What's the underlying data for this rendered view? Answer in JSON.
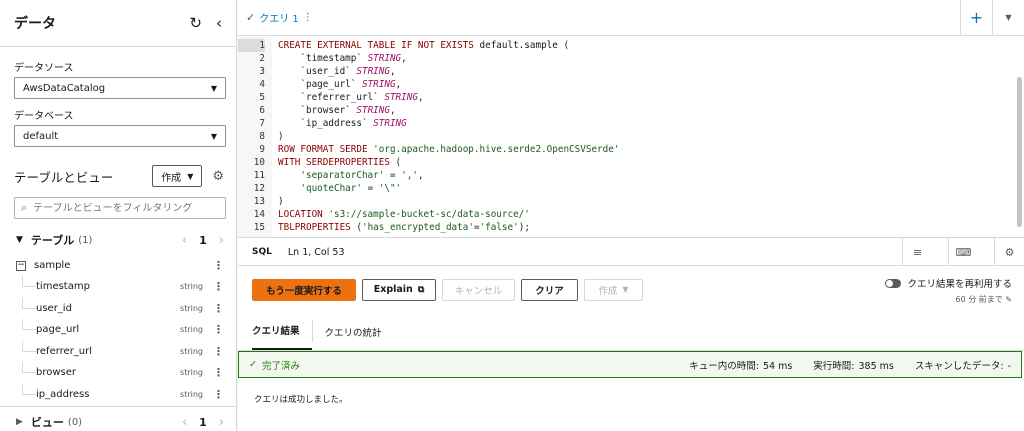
{
  "left": {
    "title": "データ",
    "datasource_label": "データソース",
    "datasource_value": "AwsDataCatalog",
    "database_label": "データベース",
    "database_value": "default",
    "tv_title": "テーブルとビュー",
    "create_label": "作成",
    "search_placeholder": "テーブルとビューをフィルタリング",
    "tables_label": "テーブル",
    "tables_count": "(1)",
    "tables_page": "1",
    "table_name": "sample",
    "columns": [
      {
        "name": "timestamp",
        "type": "string"
      },
      {
        "name": "user_id",
        "type": "string"
      },
      {
        "name": "page_url",
        "type": "string"
      },
      {
        "name": "referrer_url",
        "type": "string"
      },
      {
        "name": "browser",
        "type": "string"
      },
      {
        "name": "ip_address",
        "type": "string"
      }
    ],
    "views_label": "ビュー",
    "views_count": "(0)",
    "views_page": "1"
  },
  "editor": {
    "tab_label": "クエリ 1",
    "tab_more": "⋮",
    "language": "SQL",
    "cursor": "Ln 1, Col 53",
    "lines": [
      {
        "n": "1",
        "parts": [
          [
            "kw",
            "CREATE EXTERNAL TABLE IF NOT EXISTS "
          ],
          [
            "pl",
            "default.sample ("
          ]
        ]
      },
      {
        "n": "2",
        "parts": [
          [
            "pl",
            "    `timestamp` "
          ],
          [
            "ty",
            "STRING"
          ],
          [
            "pl",
            ","
          ]
        ]
      },
      {
        "n": "3",
        "parts": [
          [
            "pl",
            "    `user_id` "
          ],
          [
            "ty",
            "STRING"
          ],
          [
            "pl",
            ","
          ]
        ]
      },
      {
        "n": "4",
        "parts": [
          [
            "pl",
            "    `page_url` "
          ],
          [
            "ty",
            "STRING"
          ],
          [
            "pl",
            ","
          ]
        ]
      },
      {
        "n": "5",
        "parts": [
          [
            "pl",
            "    `referrer_url` "
          ],
          [
            "ty",
            "STRING"
          ],
          [
            "pl",
            ","
          ]
        ]
      },
      {
        "n": "6",
        "parts": [
          [
            "pl",
            "    `browser` "
          ],
          [
            "ty",
            "STRING"
          ],
          [
            "pl",
            ","
          ]
        ]
      },
      {
        "n": "7",
        "parts": [
          [
            "pl",
            "    `ip_address` "
          ],
          [
            "ty",
            "STRING"
          ]
        ]
      },
      {
        "n": "8",
        "parts": [
          [
            "pl",
            ")"
          ]
        ]
      },
      {
        "n": "9",
        "parts": [
          [
            "kw",
            "ROW FORMAT SERDE "
          ],
          [
            "st",
            "'org.apache.hadoop.hive.serde2.OpenCSVSerde'"
          ]
        ]
      },
      {
        "n": "10",
        "parts": [
          [
            "kw",
            "WITH SERDEPROPERTIES "
          ],
          [
            "pl",
            "("
          ]
        ]
      },
      {
        "n": "11",
        "parts": [
          [
            "pl",
            "    "
          ],
          [
            "st",
            "'separatorChar'"
          ],
          [
            "pl",
            " = "
          ],
          [
            "st",
            "','"
          ],
          [
            "pl",
            ","
          ]
        ]
      },
      {
        "n": "12",
        "parts": [
          [
            "pl",
            "    "
          ],
          [
            "st",
            "'quoteChar'"
          ],
          [
            "pl",
            " = "
          ],
          [
            "st",
            "'\\\"'"
          ]
        ]
      },
      {
        "n": "13",
        "parts": [
          [
            "pl",
            ")"
          ]
        ]
      },
      {
        "n": "14",
        "parts": [
          [
            "kw",
            "LOCATION "
          ],
          [
            "st",
            "'s3://sample-bucket-sc/data-source/'"
          ]
        ]
      },
      {
        "n": "15",
        "parts": [
          [
            "kw",
            "TBLPROPERTIES "
          ],
          [
            "pl",
            "("
          ],
          [
            "st",
            "'has_encrypted_data'"
          ],
          [
            "pl",
            "="
          ],
          [
            "st",
            "'false'"
          ],
          [
            "pl",
            ");"
          ]
        ]
      }
    ]
  },
  "actions": {
    "run_again": "もう一度実行する",
    "explain": "Explain",
    "cancel": "キャンセル",
    "clear": "クリア",
    "create": "作成",
    "reuse_label": "クエリ結果を再利用する",
    "reuse_sub": "60 分 前まで"
  },
  "results": {
    "tab_results": "クエリ結果",
    "tab_stats": "クエリの統計",
    "status": "完了済み",
    "queue_label": "キュー内の時間:",
    "queue_value": "54 ms",
    "exec_label": "実行時間:",
    "exec_value": "385 ms",
    "scan_label": "スキャンしたデータ:",
    "scan_value": "-",
    "message": "クエリは成功しました。"
  },
  "colors": {
    "accent": "#ec7211",
    "link": "#0073bb",
    "success": "#1d8102"
  }
}
